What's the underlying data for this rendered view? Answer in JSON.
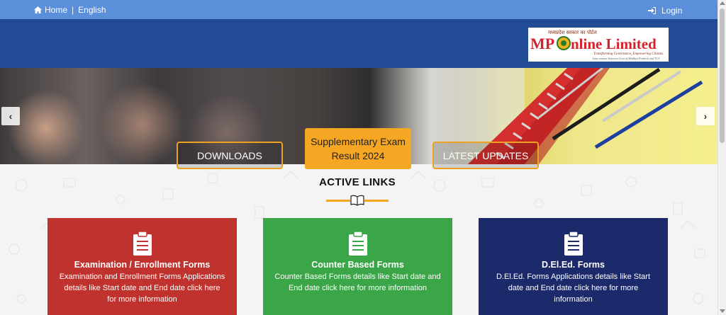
{
  "topbar": {
    "home_label": "Home",
    "separator": "|",
    "language_label": "English",
    "login_label": "Login",
    "home_icon": "home-icon",
    "login_icon": "sign-in-icon"
  },
  "logo": {
    "hindi_tagline": "मध्यप्रदेश सरकार का पोर्टल",
    "name": "MPOnline Limited",
    "tagline": "Transforming Governance, Empowering Citizens",
    "subtitle": "Joint venture between Govt of Madhya Pradesh and TCS"
  },
  "banner": {
    "prev_label": "‹",
    "next_label": "›"
  },
  "tabs": {
    "downloads": "DOWNLOADS",
    "result_line1": "Supplementary Exam",
    "result_line2": "Result 2024",
    "updates": "LATEST UPDATES"
  },
  "active_links": {
    "title": "ACTIVE LINKS",
    "divider_icon": "book-icon"
  },
  "cards": [
    {
      "title": "Examination / Enrollment Forms",
      "description": "Examination and Enrollment Forms Applications details like Start date and End date click here for more information",
      "icon": "clipboard-icon",
      "color": "#c0322d"
    },
    {
      "title": "Counter Based Forms",
      "description": "Counter Based Forms details like Start date and End date click here for more information",
      "icon": "clipboard-icon",
      "color": "#3aa647"
    },
    {
      "title": "D.El.Ed. Forms",
      "description": "D.El.Ed. Forms Applications details like Start date and End date click here for more information",
      "icon": "clipboard-icon",
      "color": "#1c2a6b"
    }
  ],
  "colors": {
    "topbar": "#5b8fd9",
    "header": "#214c95",
    "accent": "#f5a623"
  }
}
